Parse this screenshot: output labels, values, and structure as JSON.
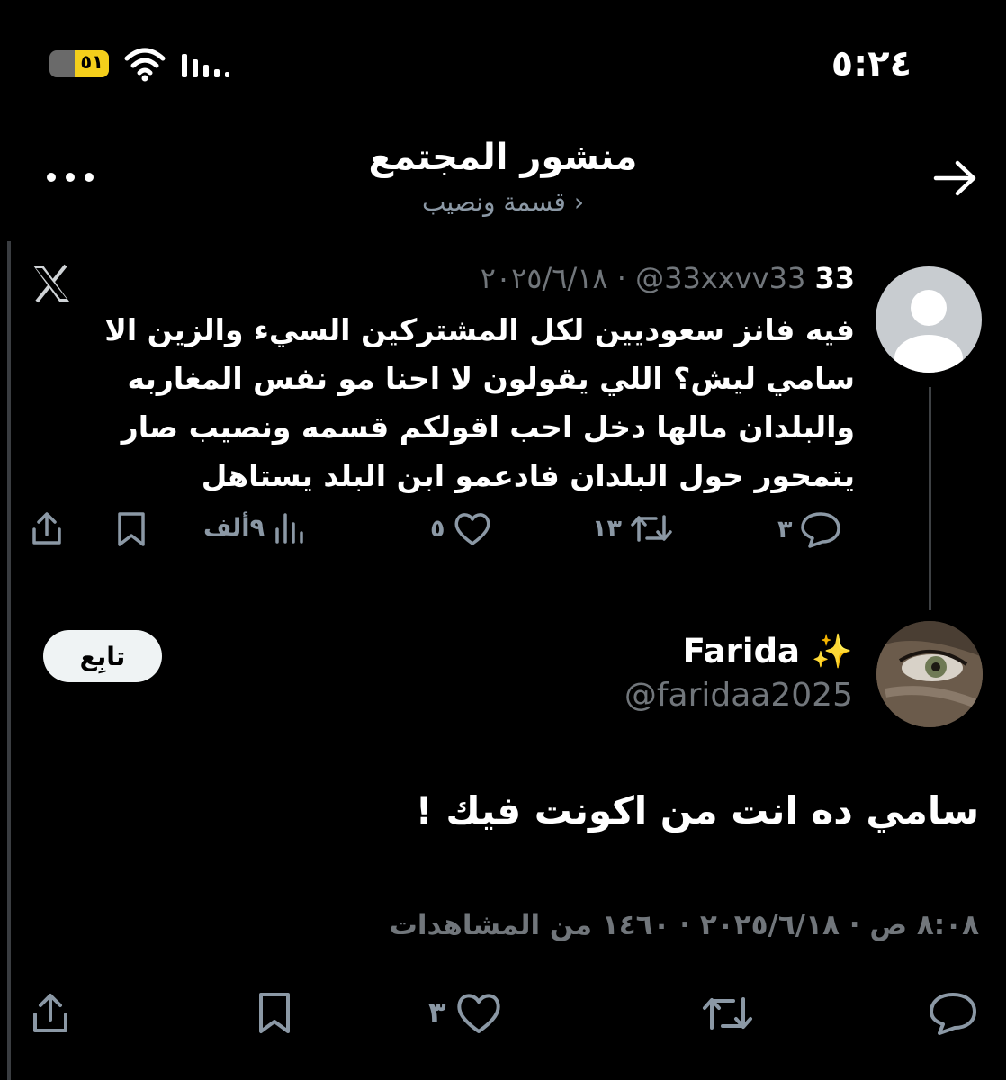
{
  "status_bar": {
    "time": "٥:٢٤",
    "battery_level": "٥١"
  },
  "header": {
    "title": "منشور المجتمع",
    "subtitle": "قسمة ونصيب ›"
  },
  "quoted": {
    "name": "33",
    "handle": "@33xxvv33",
    "separator": "·",
    "date": "٢٠٢٥/٦/١٨",
    "text": "فيه فانز سعوديين لكل المشتركين السيء والزين الا سامي ليش؟ اللي يقولون لا احنا مو نفس المغاربه والبلدان مالها دخل احب اقولكم قسمه ونصيب صار يتمحور حول البلدان فادعمو ابن البلد يستاهل",
    "replies": "٣",
    "reposts": "١٣",
    "likes": "٥",
    "views": "٩ألف"
  },
  "post": {
    "follow_label": "تابِع",
    "name": "Farida",
    "name_emoji": "✨",
    "handle": "@faridaa2025",
    "text": "سامي ده انت من اكونت فيك !",
    "meta": "٨:٠٨ ص · ٢٠٢٥/٦/١٨ · ١٤٦٠ من المشاهدات",
    "likes": "٣"
  },
  "icons": [
    "battery-icon",
    "wifi-icon",
    "signal-icon",
    "back-arrow-icon",
    "more-icon",
    "x-logo-icon",
    "reply-icon",
    "repost-icon",
    "like-icon",
    "views-icon",
    "bookmark-icon",
    "share-icon"
  ]
}
